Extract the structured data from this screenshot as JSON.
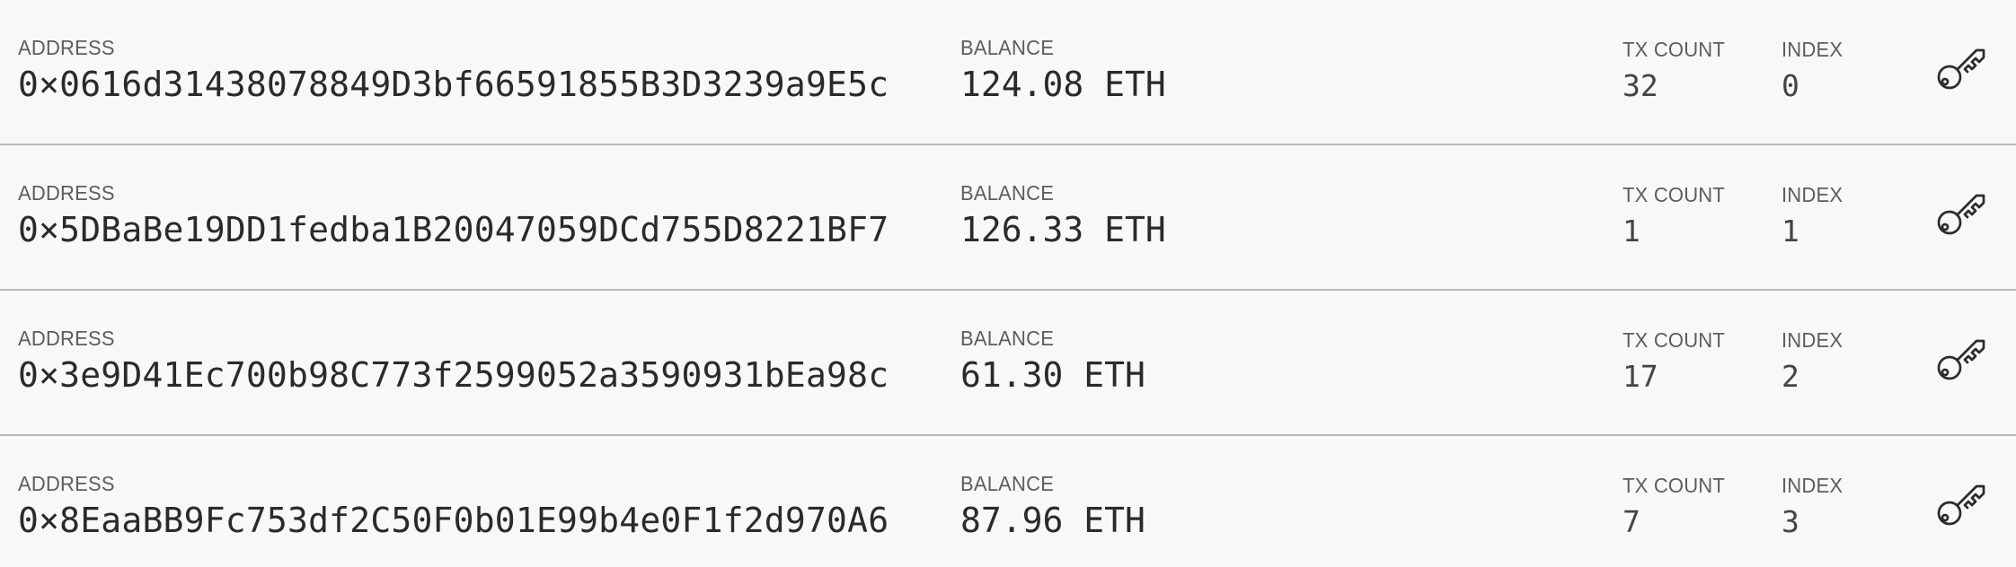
{
  "labels": {
    "address": "ADDRESS",
    "balance": "BALANCE",
    "tx_count": "TX COUNT",
    "index": "INDEX"
  },
  "accounts": [
    {
      "address": "0×0616d31438078849D3bf66591855B3D3239a9E5c",
      "balance": "124.08 ETH",
      "tx_count": "32",
      "index": "0",
      "key_icon": "key-icon"
    },
    {
      "address": "0×5DBaBe19DD1fedba1B20047059DCd755D8221BF7",
      "balance": "126.33 ETH",
      "tx_count": "1",
      "index": "1",
      "key_icon": "key-icon"
    },
    {
      "address": "0×3e9D41Ec700b98C773f2599052a3590931bEa98c",
      "balance": "61.30 ETH",
      "tx_count": "17",
      "index": "2",
      "key_icon": "key-icon"
    },
    {
      "address": "0×8EaaBB9Fc753df2C50F0b01E99b4e0F1f2d970A6",
      "balance": "87.96 ETH",
      "tx_count": "7",
      "index": "3",
      "key_icon": "key-icon"
    }
  ],
  "colors": {
    "background": "#f8f8f7",
    "divider": "#b7b7b7",
    "label": "#5d5d5d",
    "value": "#2a2a2a",
    "icon": "#2c2c2c"
  }
}
